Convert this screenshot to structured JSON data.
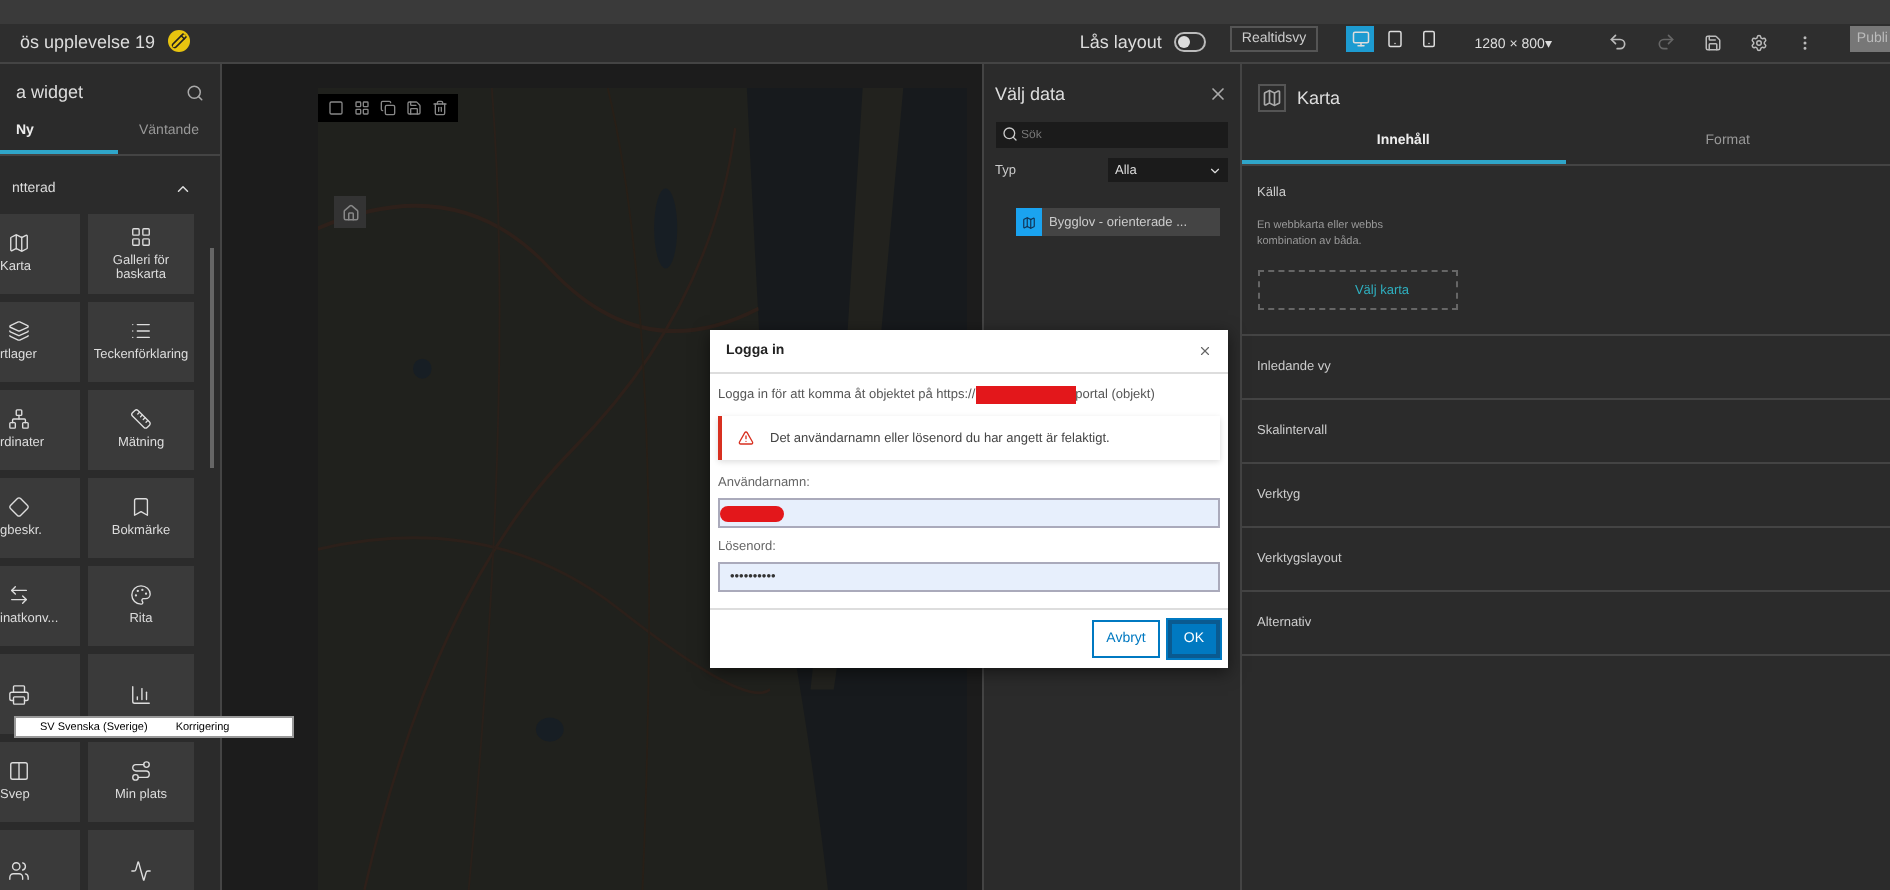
{
  "header": {
    "title": "ös upplevelse 19",
    "lock_layout": {
      "label": "Lås layout",
      "on": false
    },
    "live_view": "Realtidsvy",
    "devices": [
      {
        "kind": "desktop",
        "selected": true
      },
      {
        "kind": "tablet",
        "selected": false
      },
      {
        "kind": "phone",
        "selected": false
      }
    ],
    "resolution": "1280 × 800▾",
    "publish": "Publi"
  },
  "widget_panel": {
    "title": "a widget",
    "tabs": [
      {
        "label": "Ny",
        "selected": true
      },
      {
        "label": "Väntande",
        "selected": false
      }
    ],
    "section": {
      "label": "ntterad",
      "expanded": true
    },
    "widgets": [
      {
        "kind": "labeled",
        "label": "Karta"
      },
      {
        "kind": "labeled",
        "label": "Galleri för baskarta"
      },
      {
        "kind": "labeled",
        "label": "rtlager"
      },
      {
        "kind": "labeled",
        "label": "Teckenförklaring"
      },
      {
        "kind": "labeled",
        "label": "rdinater"
      },
      {
        "kind": "labeled",
        "label": "Mätning"
      },
      {
        "kind": "labeled",
        "label": "gbeskr."
      },
      {
        "kind": "labeled",
        "label": "Bokmärke"
      },
      {
        "kind": "labeled",
        "label": "inatkonv..."
      },
      {
        "kind": "labeled",
        "label": "Rita"
      },
      {
        "kind": "icon_only"
      },
      {
        "kind": "icon_only"
      },
      {
        "kind": "labeled",
        "label": "Svep"
      },
      {
        "kind": "labeled",
        "label": "Min plats"
      },
      {
        "kind": "icon_only"
      },
      {
        "kind": "icon_only"
      }
    ]
  },
  "language_bar": {
    "language": "SV Svenska (Sverige)",
    "correction": "Korrigering"
  },
  "login_dialog": {
    "title": "Logga in",
    "message": "Logga in för att komma åt objektet på https://",
    "message_end": "portal (objekt)",
    "error": "Det användarnamn eller lösenord du har angett är felaktigt.",
    "username_label": "Användarnamn:",
    "password_label": "Lösenord:",
    "password_value": "••••••••••",
    "buttons": [
      {
        "label": "Avbryt",
        "kind": "secondary"
      },
      {
        "label": "OK",
        "kind": "primary"
      }
    ]
  },
  "data_panel": {
    "title": "Välj data",
    "search": {
      "placeholder": "Sök"
    },
    "type_label": "Typ",
    "type_value": "Alla",
    "items": [
      {
        "label": "Bygglov - orienterade ...",
        "selected": true
      }
    ]
  },
  "settings_panel": {
    "title": "Karta",
    "tabs": [
      {
        "label": "Innehåll",
        "selected": true
      },
      {
        "label": "Format",
        "selected": false
      }
    ],
    "source_label": "Källa",
    "source_lines": [
      "En webbkarta eller webbs",
      "kombination av båda."
    ],
    "choose_map": "Välj karta",
    "sections": [
      "Inledande vy",
      "Skalintervall",
      "Verktyg",
      "Verktygslayout",
      "Alternativ"
    ]
  }
}
